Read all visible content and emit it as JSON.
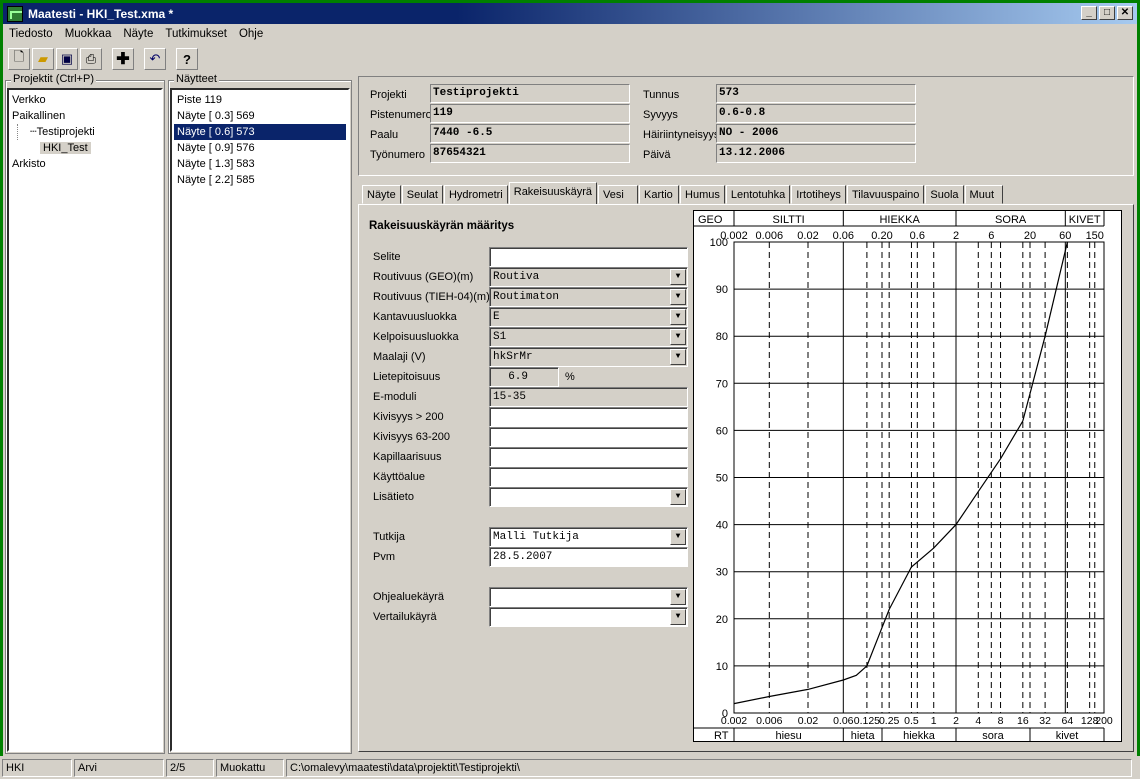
{
  "window": {
    "title": "Maatesti - HKI_Test.xma  *",
    "min": "_",
    "max": "□",
    "close": "✕"
  },
  "menu": [
    "Tiedosto",
    "Muokkaa",
    "Näyte",
    "Tutkimukset",
    "Ohje"
  ],
  "toolbar": {
    "icons": [
      "new-icon",
      "open-icon",
      "save-icon",
      "print-icon",
      "add-icon",
      "undo-icon",
      "help-icon"
    ]
  },
  "projects": {
    "label": "Projektit (Ctrl+P)",
    "items": [
      "Verkko",
      "Paikallinen",
      "Testiprojekti",
      "HKI_Test",
      "Arkisto"
    ]
  },
  "samples": {
    "label": "Näytteet",
    "items": [
      "Piste 119",
      "Näyte [ 0.3] 569",
      "Näyte [ 0.6] 573",
      "Näyte [ 0.9] 576",
      "Näyte [ 1.3] 583",
      "Näyte [ 2.2] 585"
    ],
    "selected_index": 2
  },
  "info": {
    "projekti_label": "Projekti",
    "projekti": "Testiprojekti",
    "pistenumero_label": "Pistenumero",
    "pistenumero": "119",
    "paalu_label": "Paalu",
    "paalu": "7440 -6.5",
    "tyonumero_label": "Työnumero",
    "tyonumero": "87654321",
    "tunnus_label": "Tunnus",
    "tunnus": "573",
    "syvyys_label": "Syvyys",
    "syvyys": "0.6-0.8",
    "hairiintyneisyys_label": "Häiriintyneisyys",
    "hairiintyneisyys": "NO - 2006",
    "paiva_label": "Päivä",
    "paiva": "13.12.2006"
  },
  "tabs": [
    "Näyte",
    "Seulat",
    "Hydrometri",
    "Rakeisuuskäyrä",
    "Vesi",
    "Kartio",
    "Humus",
    "Lentotuhka",
    "Irtotiheys",
    "Tilavuuspaino",
    "Suola",
    "Muut"
  ],
  "active_tab": 3,
  "form": {
    "heading": "Rakeisuuskäyrän määritys",
    "selite_label": "Selite",
    "selite": "",
    "routivuus_geo_label": "Routivuus (GEO)(m)",
    "routivuus_geo": "Routiva",
    "routivuus_tieh_label": "Routivuus (TIEH-04)(m)",
    "routivuus_tieh": "Routimaton",
    "kantavuus_label": "Kantavuusluokka",
    "kantavuus": "E",
    "kelpoisuus_label": "Kelpoisuusluokka",
    "kelpoisuus": "S1",
    "maalaji_label": "Maalaji (V)",
    "maalaji": "hkSrMr",
    "lietepitoisuus_label": "Lietepitoisuus",
    "lietepitoisuus": "6.9",
    "lietepitoisuus_unit": "%",
    "emoduli_label": "E-moduli",
    "emoduli": "15-35",
    "kivisyys200_label": "Kivisyys > 200",
    "kivisyys200": "",
    "kivisyys63_label": "Kivisyys 63-200",
    "kivisyys63": "",
    "kapillaarisuus_label": "Kapillaarisuus",
    "kapillaarisuus": "",
    "kayttoalue_label": "Käyttöalue",
    "kayttoalue": "",
    "lisatieto_label": "Lisätieto",
    "lisatieto": "",
    "tutkija_label": "Tutkija",
    "tutkija": "Malli Tutkija",
    "pvm_label": "Pvm",
    "pvm": "28.5.2007",
    "ohjealue_label": "Ohjealuekäyrä",
    "ohjealue": "",
    "vertailu_label": "Vertailukäyrä",
    "vertailu": ""
  },
  "chart_data": {
    "type": "line",
    "x_scale": "log",
    "xlim": [
      0.002,
      200
    ],
    "ylim": [
      0,
      100
    ],
    "top_band_label": "GEO",
    "top_bands": [
      "SILTTI",
      "HIEKKA",
      "SORA",
      "KIVET"
    ],
    "top_ticks": [
      "0.002",
      "0.006",
      "0.02",
      "0.06",
      "0.20",
      "0.6",
      "2",
      "6",
      "20",
      "60",
      "150"
    ],
    "bottom_band_label": "RT",
    "bottom_bands": [
      "hiesu",
      "hieta",
      "hiekka",
      "sora",
      "kivet"
    ],
    "bottom_ticks": [
      "0.002",
      "0.006",
      "0.02",
      "0.06",
      "0.125",
      "0.25",
      "0.5",
      "1",
      "2",
      "4",
      "8",
      "16",
      "32",
      "64",
      "128",
      "200"
    ],
    "y_ticks": [
      "0",
      "10",
      "20",
      "30",
      "40",
      "50",
      "60",
      "70",
      "80",
      "90",
      "100"
    ],
    "grid": true,
    "series": [
      {
        "x": [
          0.002,
          0.006,
          0.02,
          0.06,
          0.09,
          0.125,
          0.25,
          0.5,
          1,
          2,
          4,
          8,
          16,
          32,
          64
        ],
        "y": [
          2,
          3.5,
          5,
          7,
          8,
          10,
          22,
          31,
          35,
          40,
          47,
          54,
          62,
          80,
          100
        ]
      }
    ]
  },
  "status": {
    "user": "HKI",
    "name": "Arvi",
    "count": "2/5",
    "state": "Muokattu",
    "path": "C:\\omalevy\\maatesti\\data\\projektit\\Testiprojekti\\"
  }
}
